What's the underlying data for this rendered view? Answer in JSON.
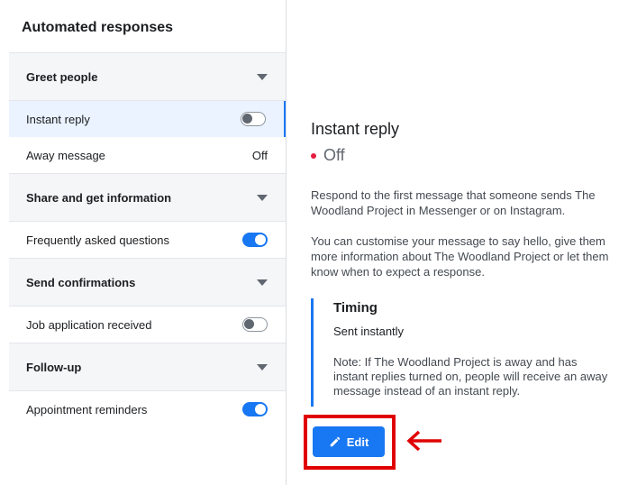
{
  "sidebar": {
    "title": "Automated responses",
    "groups": [
      {
        "label": "Greet people",
        "items": [
          {
            "label": "Instant reply",
            "state": "off",
            "selected": true
          },
          {
            "label": "Away message",
            "value": "Off"
          }
        ]
      },
      {
        "label": "Share and get information",
        "items": [
          {
            "label": "Frequently asked questions",
            "state": "on"
          }
        ]
      },
      {
        "label": "Send confirmations",
        "items": [
          {
            "label": "Job application received",
            "state": "off"
          }
        ]
      },
      {
        "label": "Follow-up",
        "items": [
          {
            "label": "Appointment reminders",
            "state": "on"
          }
        ]
      }
    ]
  },
  "detail": {
    "title": "Instant reply",
    "status": "Off",
    "description_1": "Respond to the first message that someone sends The Woodland Project in Messenger or on Instagram.",
    "description_2": "You can customise your message to say hello, give them more information about The Woodland Project or let them know when to expect a response.",
    "timing": {
      "title": "Timing",
      "value": "Sent instantly",
      "note": "Note: If The Woodland Project is away and has instant replies turned on, people will receive an away message instead of an instant reply."
    },
    "edit_label": "Edit"
  },
  "colors": {
    "accent": "#1877f2",
    "status_off": "#e41e3f",
    "highlight": "#e00000"
  },
  "icons": {
    "edit": "pencil-icon",
    "annotation": "red-arrow-icon",
    "group_toggle": "chevron-down-icon"
  }
}
